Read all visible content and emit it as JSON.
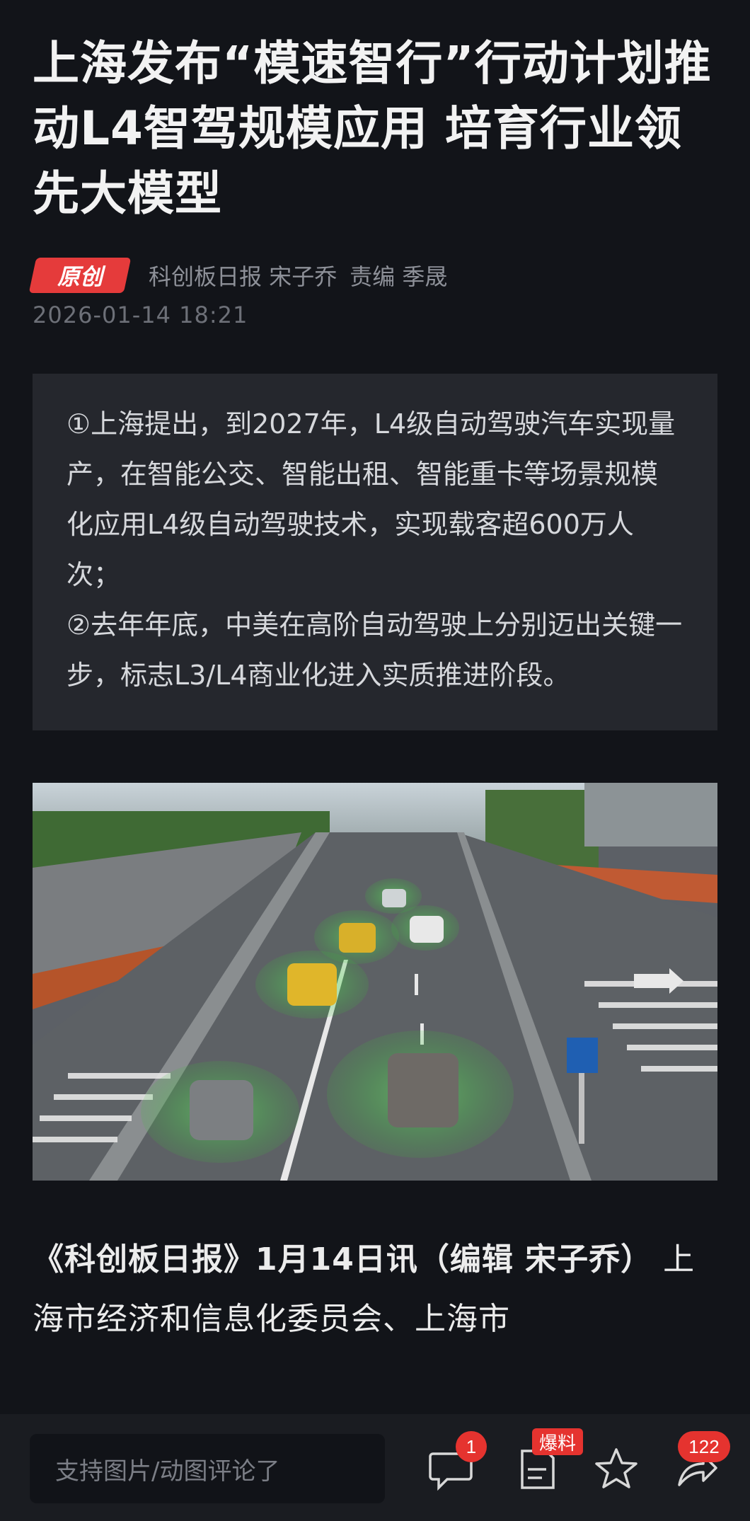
{
  "article": {
    "title": "上海发布“模速智行”行动计划推动L4智驾规模应用 培育行业领先大模型",
    "original_badge": "原创",
    "source": "科创板日报",
    "author": "宋子乔",
    "editor_label": "责编",
    "editor": "季晟",
    "datetime": "2026-01-14 18:21",
    "summary": [
      "①上海提出，到2027年，L4级自动驾驶汽车实现量产，在智能公交、智能出租、智能重卡等场景规模化应用L4级自动驾驶技术，实现载客超600万人次；",
      "②去年年底，中美在高阶自动驾驶上分别迈出关键一步，标志L3/L4商业化进入实质推进阶段。"
    ],
    "lead_bold": "《科创板日报》1月14日讯（编辑 宋子乔）",
    "lead_text": "上海市经济和信息化委员会、上海市"
  },
  "bottom_bar": {
    "comment_placeholder": "支持图片/动图评论了",
    "comment_count": "1",
    "report_label": "爆料",
    "share_count": "122",
    "icons": [
      "comment-icon",
      "report-icon",
      "star-icon",
      "share-icon"
    ]
  }
}
